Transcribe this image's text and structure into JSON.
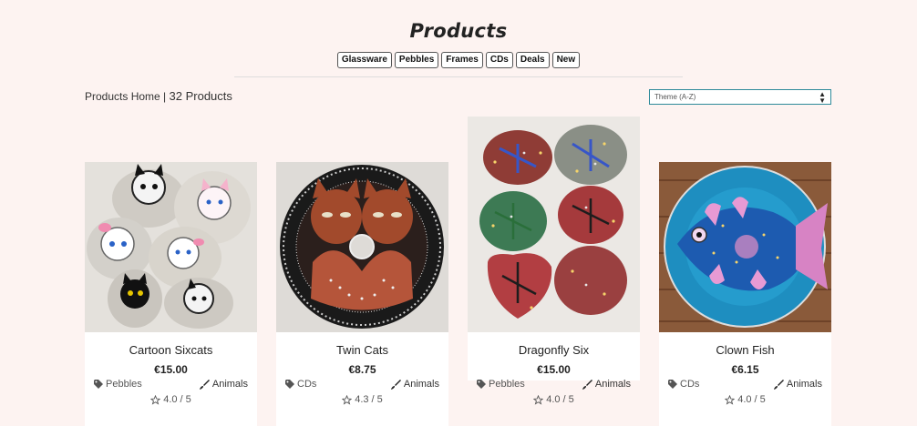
{
  "page": {
    "title": "Products"
  },
  "filters": [
    "Glassware",
    "Pebbles",
    "Frames",
    "CDs",
    "Deals",
    "New"
  ],
  "breadcrumb": {
    "home": "Products Home",
    "separator": "|",
    "count": "32 Products"
  },
  "sort": {
    "selected": "Theme (A-Z)"
  },
  "products": [
    {
      "name": "Cartoon Sixcats",
      "price": "€15.00",
      "category": "Pebbles",
      "theme": "Animals",
      "rating": "4.0 / 5"
    },
    {
      "name": "Twin Cats",
      "price": "€8.75",
      "category": "CDs",
      "theme": "Animals",
      "rating": "4.3 / 5"
    },
    {
      "name": "Dragonfly Six",
      "price": "€15.00",
      "category": "Pebbles",
      "theme": "Animals",
      "rating": "4.0 / 5"
    },
    {
      "name": "Clown Fish",
      "price": "€6.15",
      "category": "CDs",
      "theme": "Animals",
      "rating": "4.0 / 5"
    }
  ]
}
